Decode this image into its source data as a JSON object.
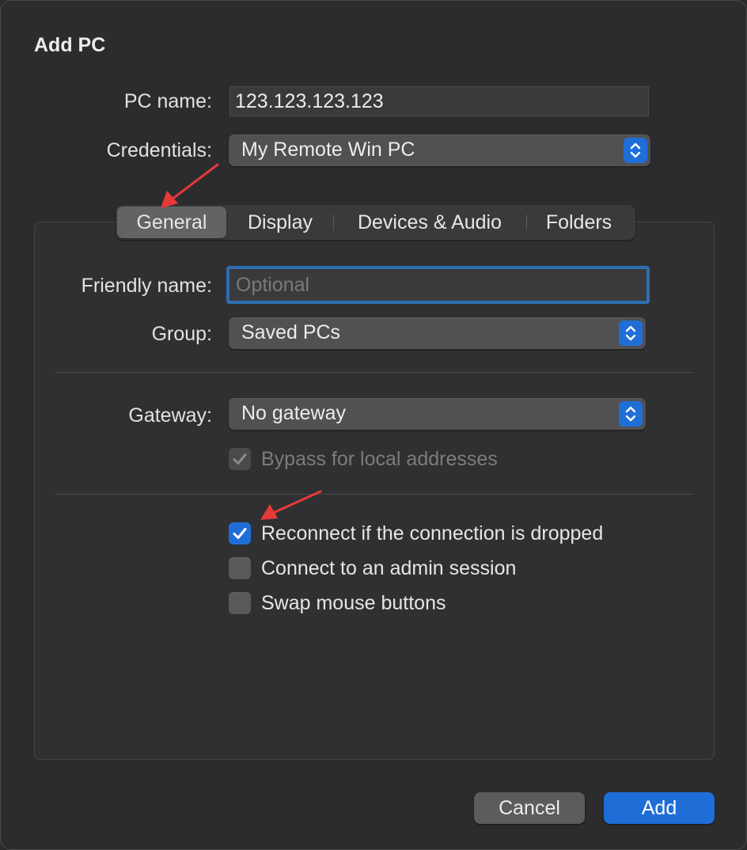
{
  "dialog": {
    "title": "Add PC"
  },
  "pc_name": {
    "label": "PC name:",
    "value": "123.123.123.123"
  },
  "credentials": {
    "label": "Credentials:",
    "value": "My Remote Win PC"
  },
  "tabs": [
    {
      "label": "General",
      "selected": true
    },
    {
      "label": "Display",
      "selected": false
    },
    {
      "label": "Devices & Audio",
      "selected": false
    },
    {
      "label": "Folders",
      "selected": false
    }
  ],
  "general": {
    "friendly_name": {
      "label": "Friendly name:",
      "value": "",
      "placeholder": "Optional"
    },
    "group": {
      "label": "Group:",
      "value": "Saved PCs"
    },
    "gateway": {
      "label": "Gateway:",
      "value": "No gateway"
    },
    "bypass_local": {
      "label": "Bypass for local addresses",
      "checked": true,
      "enabled": false
    },
    "reconnect": {
      "label": "Reconnect if the connection is dropped",
      "checked": true
    },
    "admin_session": {
      "label": "Connect to an admin session",
      "checked": false
    },
    "swap_mouse": {
      "label": "Swap mouse buttons",
      "checked": false
    }
  },
  "buttons": {
    "cancel": "Cancel",
    "add": "Add"
  },
  "colors": {
    "accent": "#1f6ed8",
    "annotation_arrow": "#e8393a",
    "background": "#2c2c2e"
  }
}
